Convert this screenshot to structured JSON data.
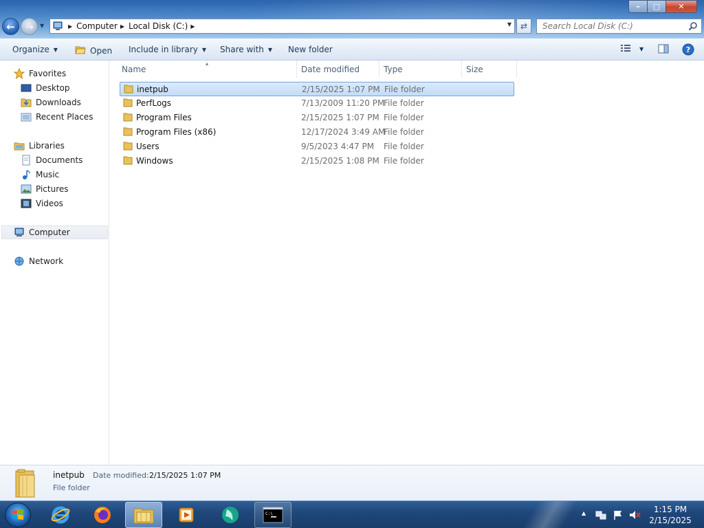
{
  "window": {
    "min_label": "–",
    "max_label": "□",
    "close_label": "✕"
  },
  "address": {
    "parts": [
      "Computer",
      "Local Disk (C:)"
    ]
  },
  "search": {
    "placeholder": "Search Local Disk (C:)"
  },
  "toolbar": {
    "organize": "Organize",
    "open": "Open",
    "include": "Include in library",
    "share": "Share with",
    "new_folder": "New folder"
  },
  "nav": {
    "favorites": "Favorites",
    "desktop": "Desktop",
    "downloads": "Downloads",
    "recent": "Recent Places",
    "libraries": "Libraries",
    "documents": "Documents",
    "music": "Music",
    "pictures": "Pictures",
    "videos": "Videos",
    "computer": "Computer",
    "network": "Network"
  },
  "columns": {
    "name": "Name",
    "date": "Date modified",
    "type": "Type",
    "size": "Size"
  },
  "files": [
    {
      "name": "inetpub",
      "date": "2/15/2025 1:07 PM",
      "type": "File folder"
    },
    {
      "name": "PerfLogs",
      "date": "7/13/2009 11:20 PM",
      "type": "File folder"
    },
    {
      "name": "Program Files",
      "date": "2/15/2025 1:07 PM",
      "type": "File folder"
    },
    {
      "name": "Program Files (x86)",
      "date": "12/17/2024 3:49 AM",
      "type": "File folder"
    },
    {
      "name": "Users",
      "date": "9/5/2023 4:47 PM",
      "type": "File folder"
    },
    {
      "name": "Windows",
      "date": "2/15/2025 1:08 PM",
      "type": "File folder"
    }
  ],
  "details": {
    "name": "inetpub",
    "date_label": "Date modified:",
    "date_value": "2/15/2025 1:07 PM",
    "type": "File folder"
  },
  "clock": {
    "time": "1:15 PM",
    "date": "2/15/2025"
  },
  "colors": {
    "selection": "#c3dcf8",
    "taskbar": "#1e4678",
    "folder": "#e8c25a"
  }
}
